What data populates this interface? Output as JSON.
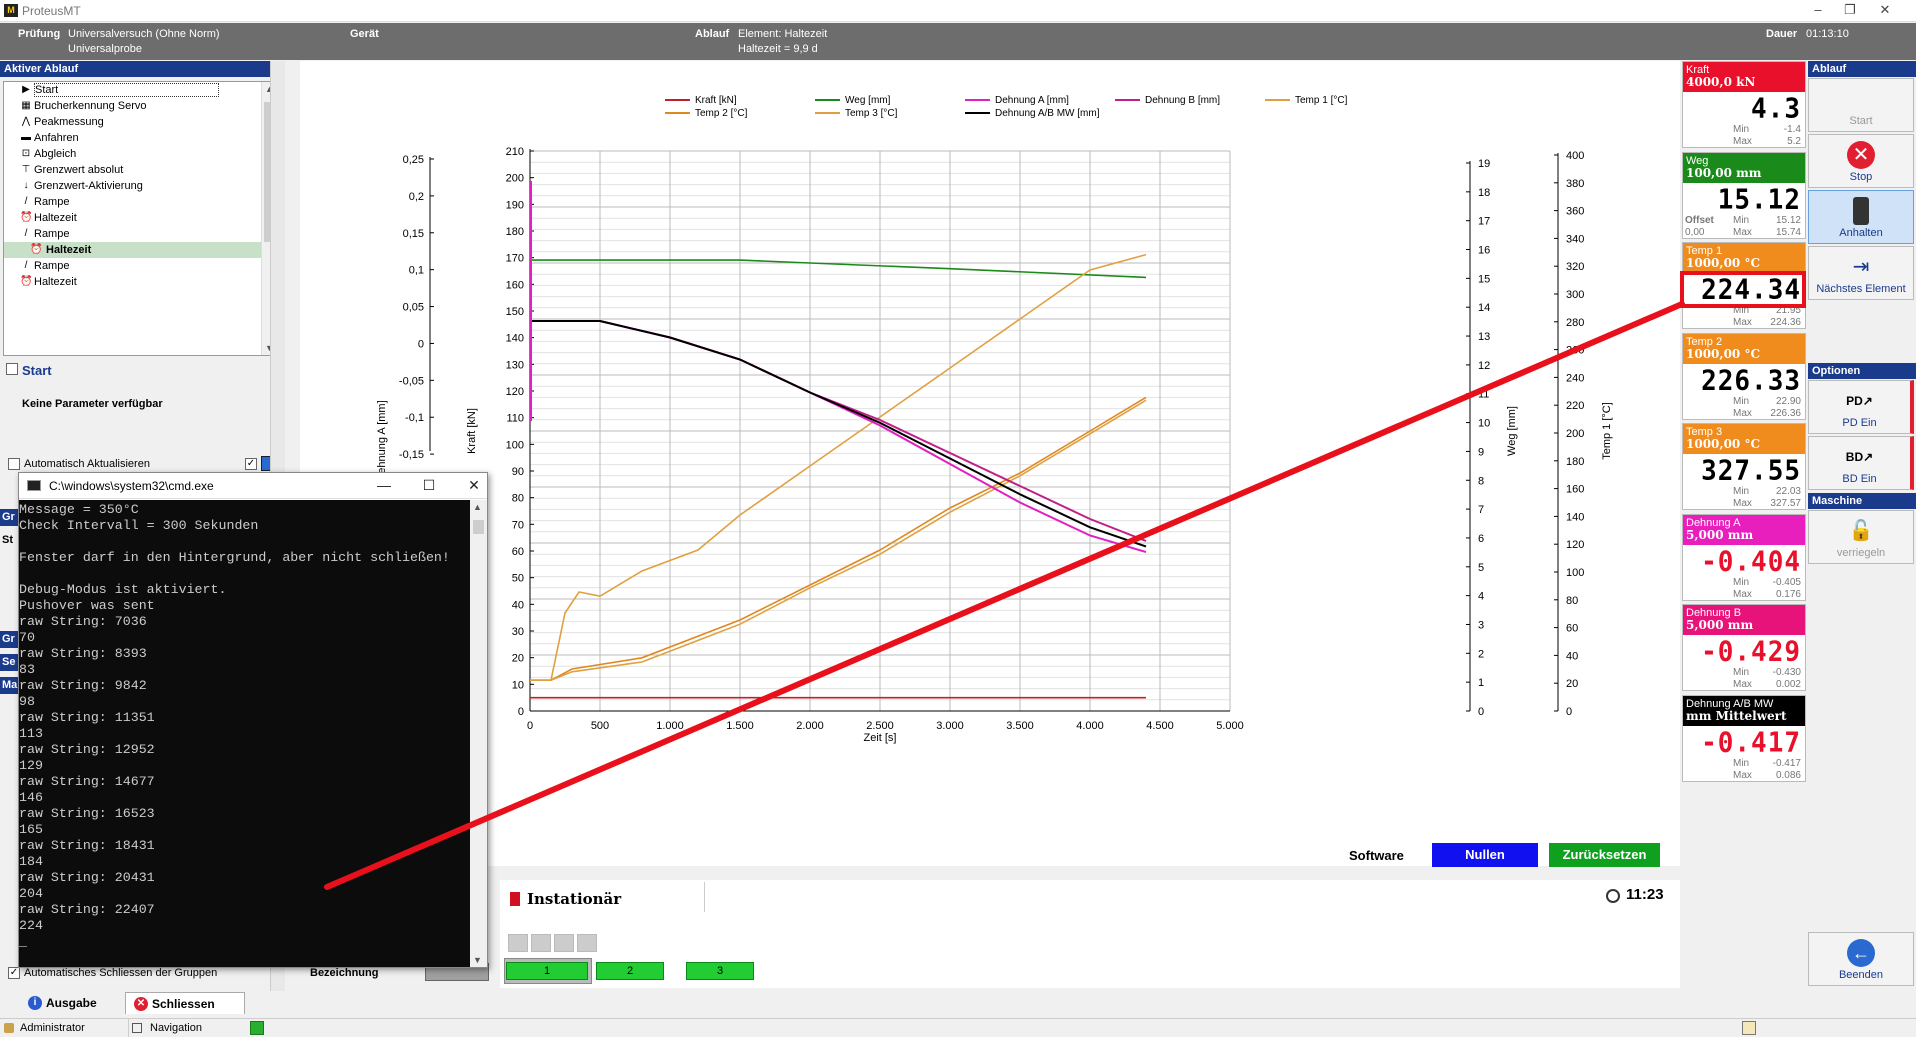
{
  "app": {
    "title": "ProteusMT"
  },
  "header": {
    "pruefung_label": "Prüfung",
    "pruefung_value1": "Universalversuch (Ohne Norm)",
    "pruefung_value2": "Universalprobe",
    "geraet_label": "Gerät",
    "ablauf_label": "Ablauf",
    "ablauf_value1": "Element: Haltezeit",
    "ablauf_value2": "Haltezeit = 9,9 d",
    "dauer_label": "Dauer",
    "dauer_value": "01:13:10"
  },
  "left_panel": {
    "title": "Aktiver Ablauf",
    "tree": [
      {
        "label": "Start",
        "icon": "start-icon"
      },
      {
        "label": "Brucherkennung Servo",
        "icon": "folder-icon"
      },
      {
        "label": "Peakmessung",
        "icon": "peak-icon"
      },
      {
        "label": "Anfahren",
        "icon": "move-icon"
      },
      {
        "label": "Abgleich",
        "icon": "calibrate-icon"
      },
      {
        "label": "Grenzwert absolut",
        "icon": "limit-icon"
      },
      {
        "label": "Grenzwert-Aktivierung",
        "icon": "limit-activate-icon"
      },
      {
        "label": "Rampe",
        "icon": "ramp-icon"
      },
      {
        "label": "Haltezeit",
        "icon": "alarm-clock-icon"
      },
      {
        "label": "Rampe",
        "icon": "ramp-icon"
      },
      {
        "label": "Haltezeit",
        "icon": "alarm-clock-icon"
      },
      {
        "label": "Rampe",
        "icon": "ramp-icon"
      },
      {
        "label": "Haltezeit",
        "icon": "alarm-clock-icon"
      }
    ],
    "selected_index": 10,
    "start_label": "Start",
    "no_params": "Keine Parameter verfügbar",
    "auto_update": "Automatisch Aktualisieren",
    "auto_close": "Automatisches Schliessen der Gruppen",
    "bezeichnung": "Bezeichnung",
    "side_fragments": [
      "Gr",
      "St",
      "Gr",
      "Se",
      "Ma"
    ]
  },
  "tabs": [
    {
      "label": "Ausgabe",
      "icon": "info-icon"
    },
    {
      "label": "Schliessen",
      "icon": "close-circle-icon"
    }
  ],
  "statusbar": {
    "user": "Administrator",
    "mode": "Navigation"
  },
  "cmd": {
    "title": "C:\\windows\\system32\\cmd.exe",
    "lines": [
      "Message = 350°C",
      "Check Intervall = 300 Sekunden",
      "",
      "Fenster darf in den Hintergrund, aber nicht schließen!",
      "",
      "Debug-Modus ist aktiviert.",
      "Pushover was sent",
      "raw String: 7036",
      "70",
      "raw String: 8393",
      "83",
      "raw String: 9842",
      "98",
      "raw String: 11351",
      "113",
      "raw String: 12952",
      "129",
      "raw String: 14677",
      "146",
      "raw String: 16523",
      "165",
      "raw String: 18431",
      "184",
      "raw String: 20431",
      "204",
      "raw String: 22407",
      "224",
      "_"
    ]
  },
  "value_panel": [
    {
      "name": "Kraft",
      "range": "4000,0 kN",
      "value": "4.3",
      "color": "#e8102a",
      "value_color": "#000",
      "min": "-1.4",
      "max": "5.2",
      "offset": null
    },
    {
      "name": "Weg",
      "range": "100,00 mm",
      "value": "15.12",
      "color": "#1a8a1a",
      "value_color": "#000",
      "min": "15.12",
      "max": "15.74",
      "offset": "0,00",
      "offset_label": "Offset"
    },
    {
      "name": "Temp 1",
      "range": "1000,00 °C",
      "value": "224.34",
      "color": "#f08c1e",
      "value_color": "#000",
      "min": "21.95",
      "max": "224.36",
      "offset": null
    },
    {
      "name": "Temp 2",
      "range": "1000,00 °C",
      "value": "226.33",
      "color": "#f08c1e",
      "value_color": "#000",
      "min": "22.90",
      "max": "226.36",
      "offset": null
    },
    {
      "name": "Temp 3",
      "range": "1000,00 °C",
      "value": "327.55",
      "color": "#f08c1e",
      "value_color": "#000",
      "min": "22.03",
      "max": "327.57",
      "offset": null
    },
    {
      "name": "Dehnung A",
      "range": "5,000 mm",
      "value": "-0.404",
      "color": "#e81fbd",
      "value_color": "#e8102a",
      "min": "-0.405",
      "max": "0.176",
      "offset": null
    },
    {
      "name": "Dehnung B",
      "range": "5,000 mm",
      "value": "-0.429",
      "color": "#e8137a",
      "value_color": "#e8102a",
      "min": "-0.430",
      "max": "0.002",
      "offset": null
    },
    {
      "name": "Dehnung A/B MW",
      "range": "mm Mittelwert",
      "value": "-0.417",
      "color": "#000000",
      "value_color": "#e8102a",
      "min": "-0.417",
      "max": "0.086",
      "offset": null
    }
  ],
  "min_label": "Min",
  "max_label": "Max",
  "button_col": {
    "ablauf_title": "Ablauf",
    "start": "Start",
    "stop": "Stop",
    "anhalten": "Anhalten",
    "next": "Nächstes Element",
    "optionen_title": "Optionen",
    "pd": "PD Ein",
    "bd": "BD Ein",
    "maschine_title": "Maschine",
    "verriegeln": "verriegeln",
    "beenden": "Beenden"
  },
  "bottom": {
    "software": "Software",
    "nullen": "Nullen",
    "zuruecksetzen": "Zurücksetzen",
    "instationaer": "Instationär",
    "time": "11:23",
    "group_buttons": [
      "1",
      "2",
      "3"
    ]
  },
  "chart_data": {
    "type": "line",
    "xlabel": "Zeit [s]",
    "xlim": [
      0,
      5000
    ],
    "x_ticks": [
      "0",
      "500",
      "1.000",
      "1.500",
      "2.000",
      "2.500",
      "3.000",
      "3.500",
      "4.000",
      "4.500",
      "5.000"
    ],
    "y_axes": [
      {
        "label": "Dehnung A [mm]",
        "ticks": [
          "0,25",
          "0,2",
          "0,15",
          "0,1",
          "0,05",
          "0",
          "-0,05",
          "-0,1",
          "-0,15"
        ]
      },
      {
        "label": "Kraft [kN]",
        "ticks": [
          "210",
          "200",
          "190",
          "180",
          "170",
          "160",
          "150",
          "140",
          "130",
          "120",
          "110",
          "100",
          "90",
          "80",
          "70",
          "60",
          "50",
          "40",
          "30",
          "20",
          "10",
          "0"
        ]
      },
      {
        "label": "Weg [mm]",
        "ticks": [
          "19",
          "18",
          "17",
          "16",
          "15",
          "14",
          "13",
          "12",
          "11",
          "10",
          "9",
          "8",
          "7",
          "6",
          "5",
          "4",
          "3",
          "2",
          "1",
          "0"
        ]
      },
      {
        "label": "Temp 1 [°C]",
        "ticks": [
          "400",
          "380",
          "360",
          "340",
          "320",
          "300",
          "280",
          "260",
          "240",
          "220",
          "200",
          "180",
          "160",
          "140",
          "120",
          "100",
          "80",
          "60",
          "40",
          "20",
          "0"
        ]
      }
    ],
    "legend": [
      "Kraft [kN]",
      "Weg [mm]",
      "Dehnung A [mm]",
      "Dehnung B [mm]",
      "Temp 1 [°C]",
      "Temp 2 [°C]",
      "Temp 3 [°C]",
      "Dehnung A/B MW [mm]"
    ],
    "legend_colors": [
      "#c0202a",
      "#1a8a1a",
      "#e020c0",
      "#c0208a",
      "#e0a040",
      "#e08820",
      "#e0a040",
      "#000000"
    ],
    "series": [
      {
        "name": "Kraft [kN]",
        "x": [
          0,
          4400
        ],
        "y": [
          5,
          5
        ]
      },
      {
        "name": "Weg [mm]",
        "x": [
          0,
          1500,
          2000,
          3000,
          4400
        ],
        "y": [
          15.7,
          15.7,
          15.6,
          15.4,
          15.1
        ]
      },
      {
        "name": "Temp 1 [°C]",
        "x": [
          0,
          150,
          250,
          350,
          500,
          800,
          1200,
          1500,
          2000,
          2500,
          3000,
          3500,
          4000,
          4400
        ],
        "y": [
          22,
          22,
          70,
          85,
          82,
          100,
          115,
          140,
          175,
          210,
          245,
          280,
          315,
          326
        ]
      },
      {
        "name": "Temp 2 [°C]",
        "x": [
          0,
          150,
          300,
          800,
          1500,
          2000,
          2500,
          3000,
          3500,
          4000,
          4400
        ],
        "y": [
          22,
          22,
          30,
          38,
          65,
          90,
          115,
          145,
          170,
          200,
          224
        ]
      },
      {
        "name": "Temp 3 [°C]",
        "x": [
          0,
          150,
          300,
          800,
          1500,
          2000,
          2500,
          3000,
          3500,
          4000,
          4400
        ],
        "y": [
          22,
          22,
          28,
          35,
          62,
          88,
          112,
          142,
          168,
          198,
          222
        ]
      },
      {
        "name": "Dehnung A [mm]",
        "x": [
          0,
          500,
          1000,
          1500,
          2000,
          2500,
          3000,
          3500,
          4000,
          4400
        ],
        "y": [
          0.0,
          0.0,
          -0.03,
          -0.07,
          -0.13,
          -0.19,
          -0.26,
          -0.33,
          -0.39,
          -0.42
        ]
      },
      {
        "name": "Dehnung B [mm]",
        "x": [
          0,
          500,
          1000,
          1500,
          2000,
          2500,
          3000,
          3500,
          4000,
          4400
        ],
        "y": [
          0.0,
          0.0,
          -0.03,
          -0.07,
          -0.13,
          -0.18,
          -0.24,
          -0.3,
          -0.36,
          -0.4
        ]
      },
      {
        "name": "Dehnung A/B MW [mm]",
        "x": [
          0,
          500,
          1000,
          1500,
          2000,
          2500,
          3000,
          3500,
          4000,
          4400
        ],
        "y": [
          0.0,
          0.0,
          -0.03,
          -0.07,
          -0.13,
          -0.185,
          -0.25,
          -0.315,
          -0.375,
          -0.41
        ]
      }
    ],
    "grid": true
  }
}
